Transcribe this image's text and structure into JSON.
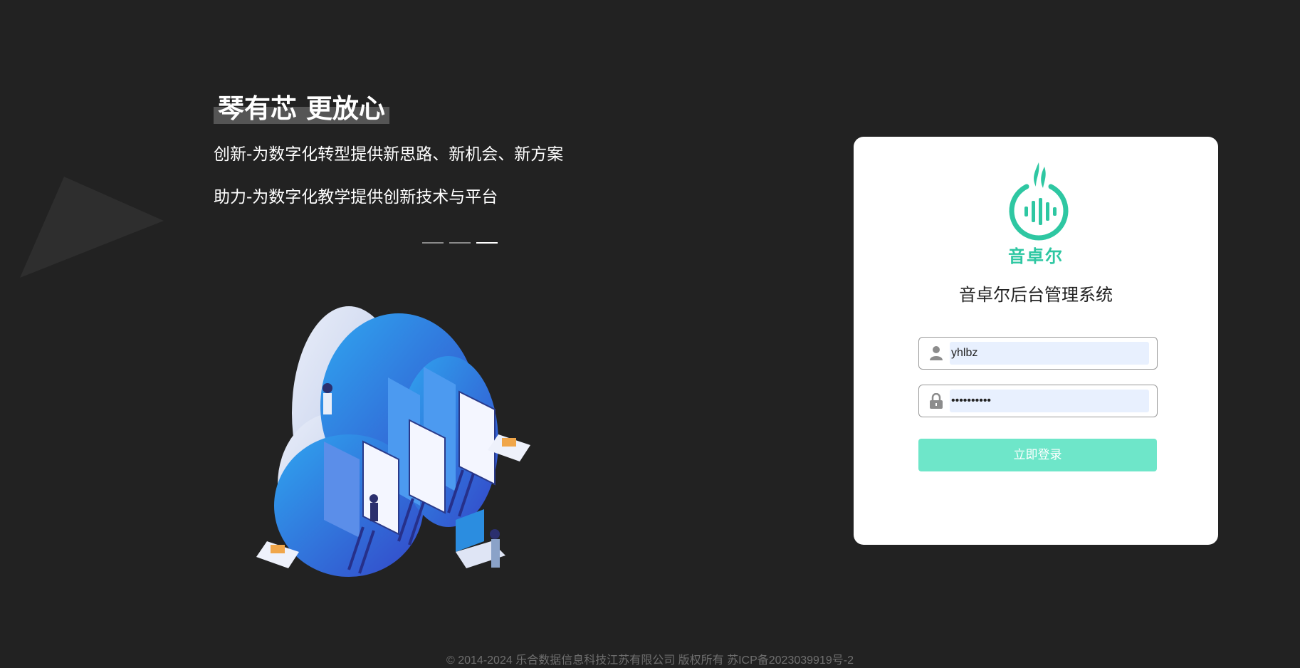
{
  "hero": {
    "slogan": "琴有芯 更放心",
    "lines": [
      "创新-为数字化转型提供新思路、新机会、新方案",
      "助力-为数字化教学提供创新技术与平台"
    ]
  },
  "carousel": {
    "count": 3,
    "active_index": 2
  },
  "login": {
    "logo_text": "音卓尔",
    "title": "音卓尔后台管理系统",
    "username": {
      "value": "yhlbz",
      "icon": "user-icon"
    },
    "password": {
      "value": "••••••••••",
      "icon": "lock-icon"
    },
    "button_label": "立即登录"
  },
  "colors": {
    "background": "#222222",
    "brand": "#2ec7a2",
    "button": "#6ee6c9"
  },
  "footer": {
    "copyright": "© 2014-2024 乐合数据信息科技江苏有限公司 版权所有 苏ICP备2023039919号-2"
  }
}
